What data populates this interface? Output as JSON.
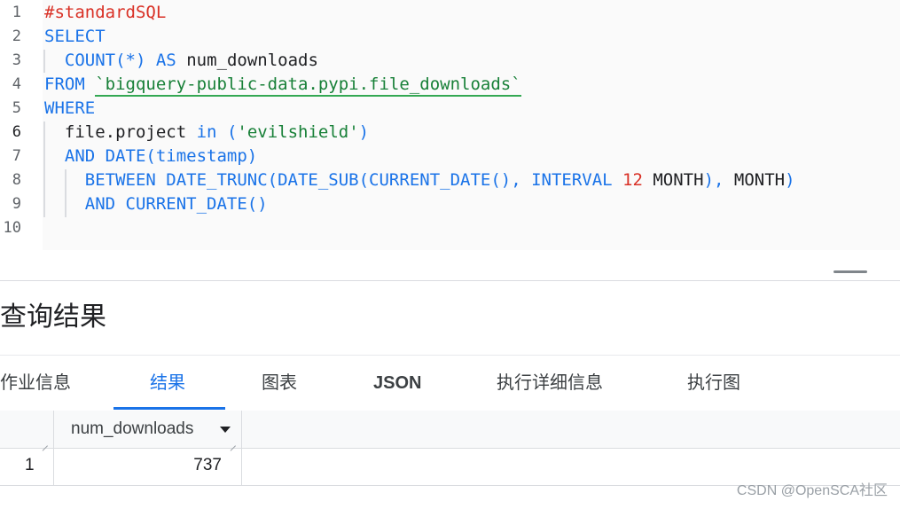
{
  "editor": {
    "line_numbers": [
      "1",
      "2",
      "3",
      "4",
      "5",
      "6",
      "7",
      "8",
      "9",
      "10"
    ],
    "lines": [
      [
        {
          "t": "#standardSQL",
          "c": "cmt"
        }
      ],
      [
        {
          "t": "SELECT",
          "c": "kw"
        }
      ],
      [
        {
          "t": "  ",
          "c": "id"
        },
        {
          "t": "COUNT",
          "c": "kw"
        },
        {
          "t": "(*)",
          "c": "kw"
        },
        {
          "t": " AS ",
          "c": "kw"
        },
        {
          "t": "num_downloads",
          "c": "id"
        }
      ],
      [
        {
          "t": "FROM ",
          "c": "kw"
        },
        {
          "t": "`bigquery-public-data.pypi.file_downloads`",
          "c": "tbl"
        }
      ],
      [
        {
          "t": "WHERE",
          "c": "kw"
        }
      ],
      [
        {
          "t": "  ",
          "c": "id"
        },
        {
          "t": "file.project",
          "c": "id"
        },
        {
          "t": " in ",
          "c": "kw"
        },
        {
          "t": "(",
          "c": "kw"
        },
        {
          "t": "'evilshield'",
          "c": "str"
        },
        {
          "t": ")",
          "c": "kw"
        }
      ],
      [
        {
          "t": "  ",
          "c": "id"
        },
        {
          "t": "AND DATE(",
          "c": "kw"
        },
        {
          "t": "timestamp",
          "c": "kw"
        },
        {
          "t": ")",
          "c": "kw"
        }
      ],
      [
        {
          "t": "    ",
          "c": "id"
        },
        {
          "t": "BETWEEN DATE_TRUNC(DATE_SUB(CURRENT_DATE(), INTERVAL ",
          "c": "kw"
        },
        {
          "t": "12",
          "c": "num"
        },
        {
          "t": " MONTH",
          "c": "id"
        },
        {
          "t": "), ",
          "c": "kw"
        },
        {
          "t": "MONTH",
          "c": "id"
        },
        {
          "t": ")",
          "c": "kw"
        }
      ],
      [
        {
          "t": "    ",
          "c": "id"
        },
        {
          "t": "AND CURRENT_DATE()",
          "c": "kw"
        }
      ],
      []
    ]
  },
  "results": {
    "title": "查询结果",
    "tabs": [
      "作业信息",
      "结果",
      "图表",
      "JSON",
      "执行详细信息",
      "执行图"
    ],
    "active_tab": "结果",
    "column_header": "num_downloads",
    "rows": [
      {
        "row_number": "1",
        "num_downloads": "737"
      }
    ]
  },
  "watermark": "CSDN @OpenSCA社区"
}
